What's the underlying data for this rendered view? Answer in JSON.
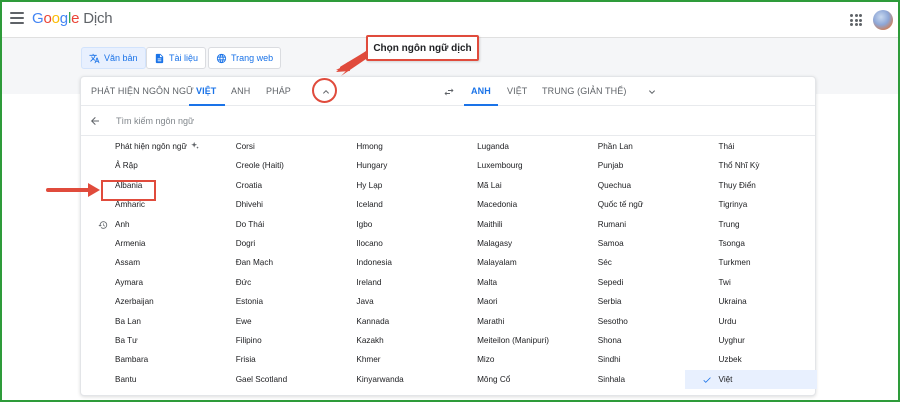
{
  "app": {
    "logo": [
      "G",
      "o",
      "o",
      "g",
      "l",
      "e"
    ],
    "product": "Dịch"
  },
  "modes": [
    {
      "label": "Văn bản",
      "icon": "translate-icon",
      "active": true
    },
    {
      "label": "Tài liệu",
      "icon": "document-icon",
      "active": false
    },
    {
      "label": "Trang web",
      "icon": "globe-icon",
      "active": false
    }
  ],
  "source_tabs": [
    "PHÁT HIỆN NGÔN NGỮ",
    "VIỆT",
    "ANH",
    "PHÁP"
  ],
  "target_tabs": [
    "ANH",
    "VIỆT",
    "TRUNG (GIẢN THỂ)"
  ],
  "search": {
    "placeholder": "Tìm kiếm ngôn ngữ",
    "value": ""
  },
  "annotation": {
    "callout": "Chọn ngôn ngữ dịch"
  },
  "columns": [
    [
      "Phát hiện ngôn ngữ",
      "Ả Rập",
      "Albania",
      "Amharic",
      "Anh",
      "Armenia",
      "Assam",
      "Aymara",
      "Azerbaijan",
      "Ba Lan",
      "Ba Tư",
      "Bambara",
      "Bantu"
    ],
    [
      "Corsi",
      "Creole (Haiti)",
      "Croatia",
      "Dhivehi",
      "Do Thái",
      "Dogri",
      "Đan Mạch",
      "Đức",
      "Estonia",
      "Ewe",
      "Filipino",
      "Frisia",
      "Gael Scotland"
    ],
    [
      "Hmong",
      "Hungary",
      "Hy Lạp",
      "Iceland",
      "Igbo",
      "Ilocano",
      "Indonesia",
      "Ireland",
      "Java",
      "Kannada",
      "Kazakh",
      "Khmer",
      "Kinyarwanda"
    ],
    [
      "Luganda",
      "Luxembourg",
      "Mã Lai",
      "Macedonia",
      "Maithili",
      "Malagasy",
      "Malayalam",
      "Malta",
      "Maori",
      "Marathi",
      "Meiteilon (Manipuri)",
      "Mizo",
      "Mông Cổ"
    ],
    [
      "Phần Lan",
      "Punjab",
      "Quechua",
      "Quốc tế ngữ",
      "Rumani",
      "Samoa",
      "Séc",
      "Sepedi",
      "Serbia",
      "Sesotho",
      "Shona",
      "Sindhi",
      "Sinhala"
    ],
    [
      "Thái",
      "Thổ Nhĩ Kỳ",
      "Thụy Điển",
      "Tigrinya",
      "Trung",
      "Tsonga",
      "Turkmen",
      "Twi",
      "Ukraina",
      "Urdu",
      "Uyghur",
      "Uzbek",
      "Việt"
    ]
  ],
  "colors": {
    "accent": "#1a73e8",
    "annotation": "#e04b3c",
    "frame": "#2e9b3a",
    "selected_bg": "#e8f0fe"
  }
}
